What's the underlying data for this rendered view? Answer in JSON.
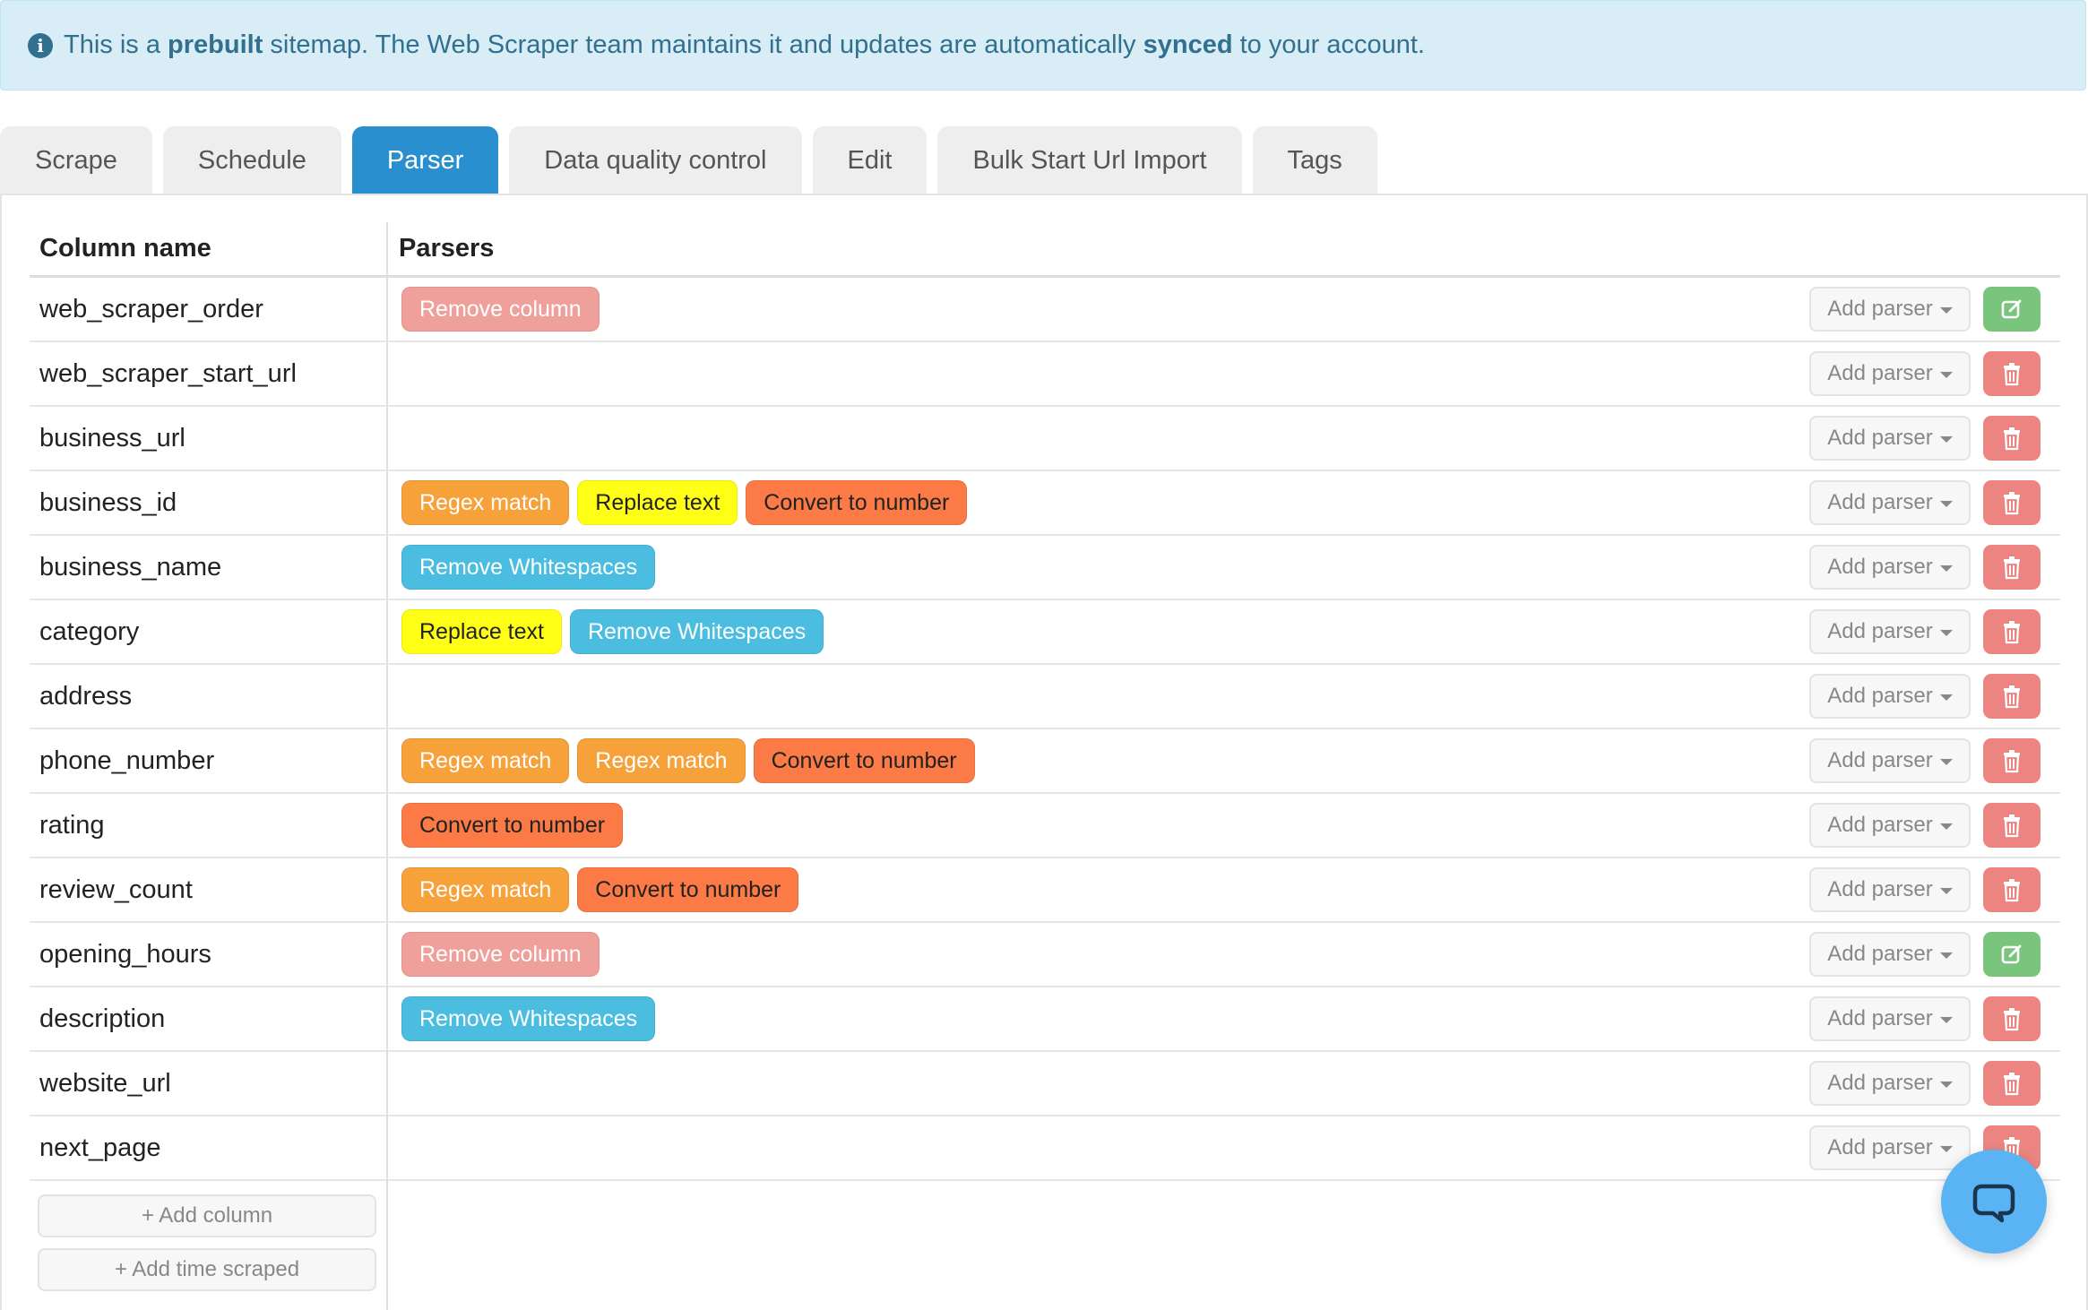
{
  "banner": {
    "pre": "This is a ",
    "bold1": "prebuilt",
    "mid": " sitemap. The Web Scraper team maintains it and updates are automatically ",
    "bold2": "synced",
    "post": " to your account."
  },
  "tabs": [
    {
      "label": "Scrape",
      "active": false
    },
    {
      "label": "Schedule",
      "active": false
    },
    {
      "label": "Parser",
      "active": true
    },
    {
      "label": "Data quality control",
      "active": false
    },
    {
      "label": "Edit",
      "active": false
    },
    {
      "label": "Bulk Start Url Import",
      "active": false
    },
    {
      "label": "Tags",
      "active": false
    }
  ],
  "table": {
    "headers": {
      "column_name": "Column name",
      "parsers": "Parsers"
    },
    "add_parser_label": "Add parser",
    "rows": [
      {
        "name": "web_scraper_order",
        "parsers": [
          "Remove column"
        ],
        "action": "edit"
      },
      {
        "name": "web_scraper_start_url",
        "parsers": [],
        "action": "delete"
      },
      {
        "name": "business_url",
        "parsers": [],
        "action": "delete"
      },
      {
        "name": "business_id",
        "parsers": [
          "Regex match",
          "Replace text",
          "Convert to number"
        ],
        "action": "delete"
      },
      {
        "name": "business_name",
        "parsers": [
          "Remove Whitespaces"
        ],
        "action": "delete"
      },
      {
        "name": "category",
        "parsers": [
          "Replace text",
          "Remove Whitespaces"
        ],
        "action": "delete"
      },
      {
        "name": "address",
        "parsers": [],
        "action": "delete"
      },
      {
        "name": "phone_number",
        "parsers": [
          "Regex match",
          "Regex match",
          "Convert to number"
        ],
        "action": "delete"
      },
      {
        "name": "rating",
        "parsers": [
          "Convert to number"
        ],
        "action": "delete"
      },
      {
        "name": "review_count",
        "parsers": [
          "Regex match",
          "Convert to number"
        ],
        "action": "delete"
      },
      {
        "name": "opening_hours",
        "parsers": [
          "Remove column"
        ],
        "action": "edit"
      },
      {
        "name": "description",
        "parsers": [
          "Remove Whitespaces"
        ],
        "action": "delete"
      },
      {
        "name": "website_url",
        "parsers": [],
        "action": "delete"
      },
      {
        "name": "next_page",
        "parsers": [],
        "action": "delete"
      }
    ]
  },
  "buttons": {
    "add_column": "+ Add column",
    "add_time_scraped": "+ Add time scraped"
  },
  "colors": {
    "accent": "#2a8fce",
    "remove_column": "#f0a09b",
    "regex_match": "#f6a13a",
    "replace_text": "#ffff15",
    "convert_to_number": "#fb7a45",
    "remove_whitespaces": "#4bbde0",
    "edit_button": "#79c57e",
    "delete_button": "#ec8582",
    "chat": "#5ab4f3"
  },
  "icons": {
    "banner": "info-icon",
    "edit": "edit-icon",
    "delete": "trash-icon",
    "chat": "chat-bubble-icon"
  }
}
